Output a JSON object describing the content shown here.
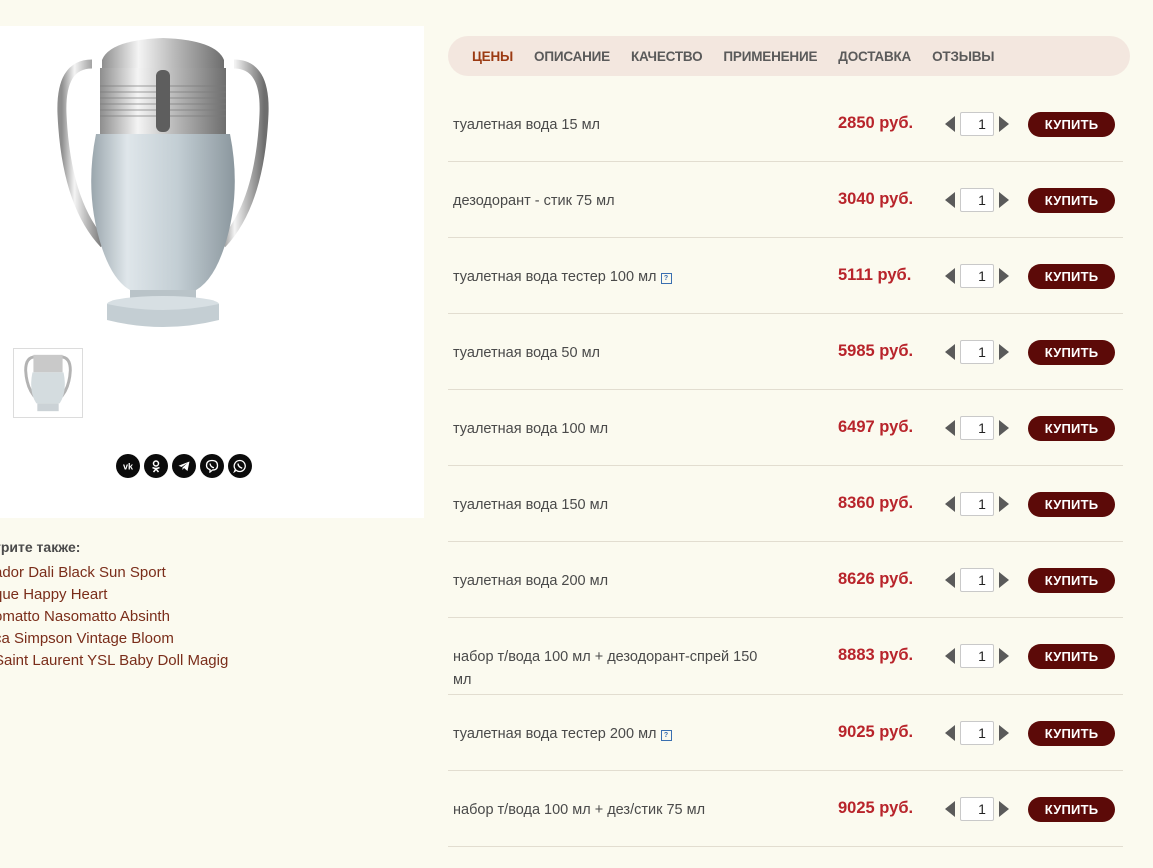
{
  "tabs": [
    {
      "label": "ЦЕНЫ",
      "active": true
    },
    {
      "label": "ОПИСАНИЕ",
      "active": false
    },
    {
      "label": "КАЧЕСТВО",
      "active": false
    },
    {
      "label": "ПРИМЕНЕНИЕ",
      "active": false
    },
    {
      "label": "ДОСТАВКА",
      "active": false
    },
    {
      "label": "ОТЗЫВЫ",
      "active": false
    }
  ],
  "buy_label": "КУПИТЬ",
  "help_glyph": "?",
  "products": [
    {
      "name": "туалетная вода 15 мл",
      "price": "2850 руб.",
      "qty": "1",
      "help": false
    },
    {
      "name": "дезодорант - стик 75 мл",
      "price": "3040 руб.",
      "qty": "1",
      "help": false
    },
    {
      "name": "туалетная вода тестер 100 мл",
      "price": "5111 руб.",
      "qty": "1",
      "help": true
    },
    {
      "name": "туалетная вода 50 мл",
      "price": "5985 руб.",
      "qty": "1",
      "help": false
    },
    {
      "name": "туалетная вода 100 мл",
      "price": "6497 руб.",
      "qty": "1",
      "help": false
    },
    {
      "name": "туалетная вода 150 мл",
      "price": "8360 руб.",
      "qty": "1",
      "help": false
    },
    {
      "name": "туалетная вода 200 мл",
      "price": "8626 руб.",
      "qty": "1",
      "help": false
    },
    {
      "name": "набор т/вода 100 мл + дезодорант-спрей 150 мл",
      "price": "8883 руб.",
      "qty": "1",
      "help": false,
      "tall": true
    },
    {
      "name": "туалетная вода тестер 200 мл",
      "price": "9025 руб.",
      "qty": "1",
      "help": true
    },
    {
      "name": "набор т/вода 100 мл + дез/стик 75 мл",
      "price": "9025 руб.",
      "qty": "1",
      "help": false
    }
  ],
  "see_also": {
    "title": "трите также:",
    "items": [
      "ador Dali Black Sun Sport",
      "que Happy Heart",
      "omatto Nasomatto Absinth",
      "ca Simpson Vintage Bloom",
      "Saint Laurent YSL Baby Doll Magig"
    ]
  },
  "share": [
    "vk-icon",
    "odnoklassniki-icon",
    "telegram-icon",
    "viber-icon",
    "whatsapp-icon"
  ],
  "colors": {
    "background": "#fbfaef",
    "tab_bar": "#f3e7df",
    "active_tab": "#9b3a12",
    "price": "#b8242b",
    "buy_button": "#5c0a08",
    "link": "#7a2d1a"
  }
}
